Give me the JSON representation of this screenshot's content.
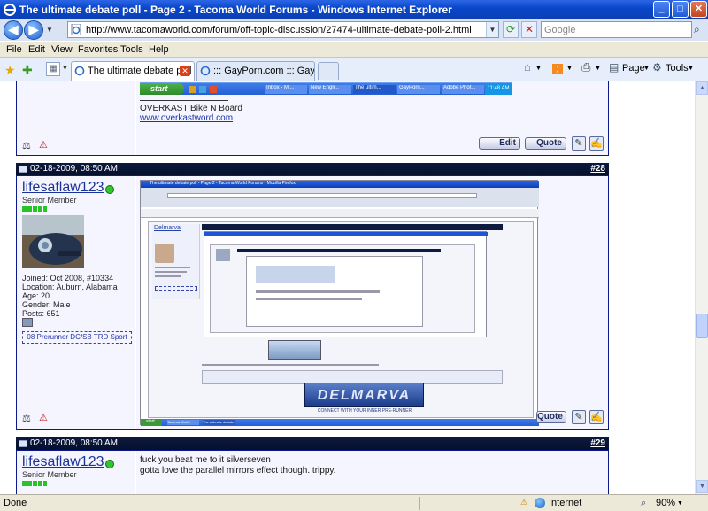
{
  "window": {
    "title": "The ultimate debate poll - Page 2 - Tacoma World Forums - Windows Internet Explorer",
    "minimize": "_",
    "maximize": "□",
    "close": "✕"
  },
  "nav": {
    "back": "◀",
    "forward": "▶",
    "address": "http://www.tacomaworld.com/forum/off-topic-discussion/27474-ultimate-debate-poll-2.html",
    "search_placeholder": "Google"
  },
  "menu": [
    "File",
    "Edit",
    "View",
    "Favorites",
    "Tools",
    "Help"
  ],
  "tabs": [
    {
      "label": "The ultimate debate poll -...",
      "active": true
    },
    {
      "label": "::: GayPorn.com ::: Gay Por...",
      "active": false
    }
  ],
  "commands": {
    "page": "Page",
    "tools": "Tools"
  },
  "posts": {
    "prev": {
      "taskbar_start": "start",
      "taskbar_items": [
        "Inbox - Mi...",
        "New Engli...",
        "The ultim...",
        "GayPorn...",
        "Adobe Phot..."
      ],
      "taskbar_clock": "11:48 AM",
      "sig_line": "OVERKAST Bike N Board",
      "sig_link": "www.overkastword.com",
      "edit": "Edit",
      "quote": "Quote"
    },
    "p28": {
      "date": "02-18-2009, 08:50 AM",
      "number": "#28",
      "username": "lifesaflaw123",
      "rank": "Senior Member",
      "joined": "Joined: Oct 2008, #10334",
      "location": "Location: Auburn, Alabama",
      "age": "Age: 20",
      "gender": "Gender: Male",
      "posts": "Posts: 651",
      "truck": "08 Prerunner DC/SB TRD Sport",
      "quote": "Quote",
      "nested_title": "The ultimate debate poll - Page 2 - Tacoma World Forums - Mozilla Firefox",
      "nested_user": "Delmarva",
      "nested_banner": "DELMARVA",
      "nested_tagline": "CONNECT WITH YOUR INNER PRE-RUNNER",
      "nested_taskbar": [
        "start",
        "Tacoma World",
        "The ultimate debate"
      ]
    },
    "p29": {
      "date": "02-18-2009, 08:50 AM",
      "number": "#29",
      "username": "lifesaflaw123",
      "rank": "Senior Member",
      "line1": "fuck you beat me to it silverseven",
      "line2": "gotta love the parallel mirrors effect though. trippy."
    }
  },
  "status": {
    "left": "Done",
    "zone": "Internet",
    "zoom": "90%"
  }
}
